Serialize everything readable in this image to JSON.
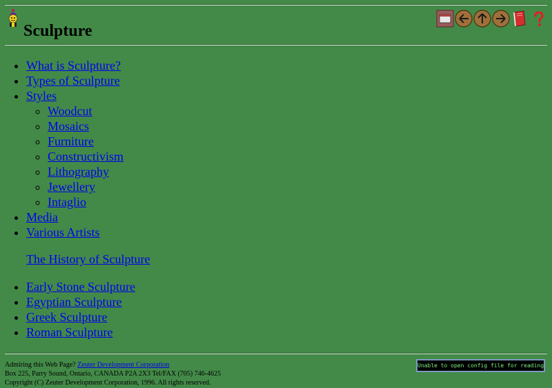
{
  "header": {
    "title": "Sculpture",
    "logo_icon": "jester-mascot-icon",
    "nav_buttons": [
      {
        "icon": "home-frame-icon"
      },
      {
        "icon": "arrow-left-icon"
      },
      {
        "icon": "arrow-up-icon"
      },
      {
        "icon": "arrow-right-icon"
      },
      {
        "icon": "book-icon"
      },
      {
        "icon": "question-mark-icon"
      }
    ]
  },
  "main": {
    "items": [
      {
        "label": "What is Sculpture?"
      },
      {
        "label": "Types of Sculpture"
      },
      {
        "label": "Styles"
      },
      {
        "label": "Media"
      },
      {
        "label": "Various Artists"
      }
    ],
    "styles_subitems": [
      {
        "label": "Woodcut"
      },
      {
        "label": "Mosaics"
      },
      {
        "label": "Furniture"
      },
      {
        "label": "Constructivism"
      },
      {
        "label": "Lithography"
      },
      {
        "label": "Jewellery"
      },
      {
        "label": "Intaglio"
      }
    ]
  },
  "history": {
    "heading": "The History of Sculpture",
    "items": [
      {
        "label": "Early Stone Sculpture"
      },
      {
        "label": "Egyptian Sculpture"
      },
      {
        "label": "Greek Sculpture"
      },
      {
        "label": "Roman Sculpture"
      }
    ]
  },
  "footer": {
    "admire_text": "Admiring this Web Page?",
    "company_link": "Zeuter Development Corporation",
    "address": "Box 225, Parry Sound, Ontario, CANADA P2A 2X3 Tel/FAX (705) 746-4625",
    "copyright": "Copyright (C) Zeuter Development Corporation, 1996. All rights reserved."
  },
  "status": {
    "message": "Unable to open config file for reading"
  },
  "colors": {
    "background": "#438a48",
    "link": "#0000ee",
    "status_text": "#7cf07c"
  }
}
